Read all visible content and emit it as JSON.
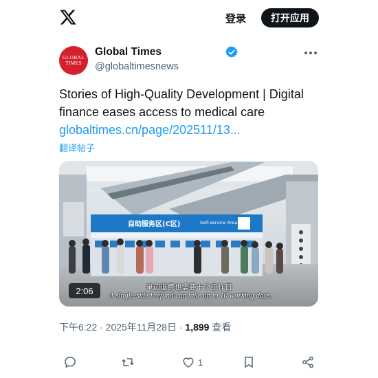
{
  "header": {
    "logo_icon": "x-logo-icon",
    "login_label": "登录",
    "open_app_label": "打开应用"
  },
  "author": {
    "avatar_text": [
      "GLOBAL",
      "TIMES"
    ],
    "name": "Global Times",
    "handle": "@globaltimesnews",
    "verified": true
  },
  "tweet": {
    "text": "Stories of High-Quality Development | Digital finance eases access to medical care",
    "link": "globaltimes.cn/page/202511/13...",
    "translate_label": "翻译帖子"
  },
  "media": {
    "duration": "2:06",
    "sign_title": "自助服务区(C区)",
    "sign_subtitle": "Self-service Area",
    "subtitle_cn": "单边退费也需要十个工作日",
    "subtitle_en": "A single-sided refund can take up to 10 working days,"
  },
  "meta": {
    "time": "下午6:22",
    "date": "2025年11月28日",
    "views_count": "1,899",
    "views_label": "查看"
  },
  "actions": {
    "like_count": "1"
  },
  "colors": {
    "accent": "#1d9bf0",
    "text": "#0f1419",
    "secondary": "#536471",
    "avatar_red": "#d4202a"
  }
}
